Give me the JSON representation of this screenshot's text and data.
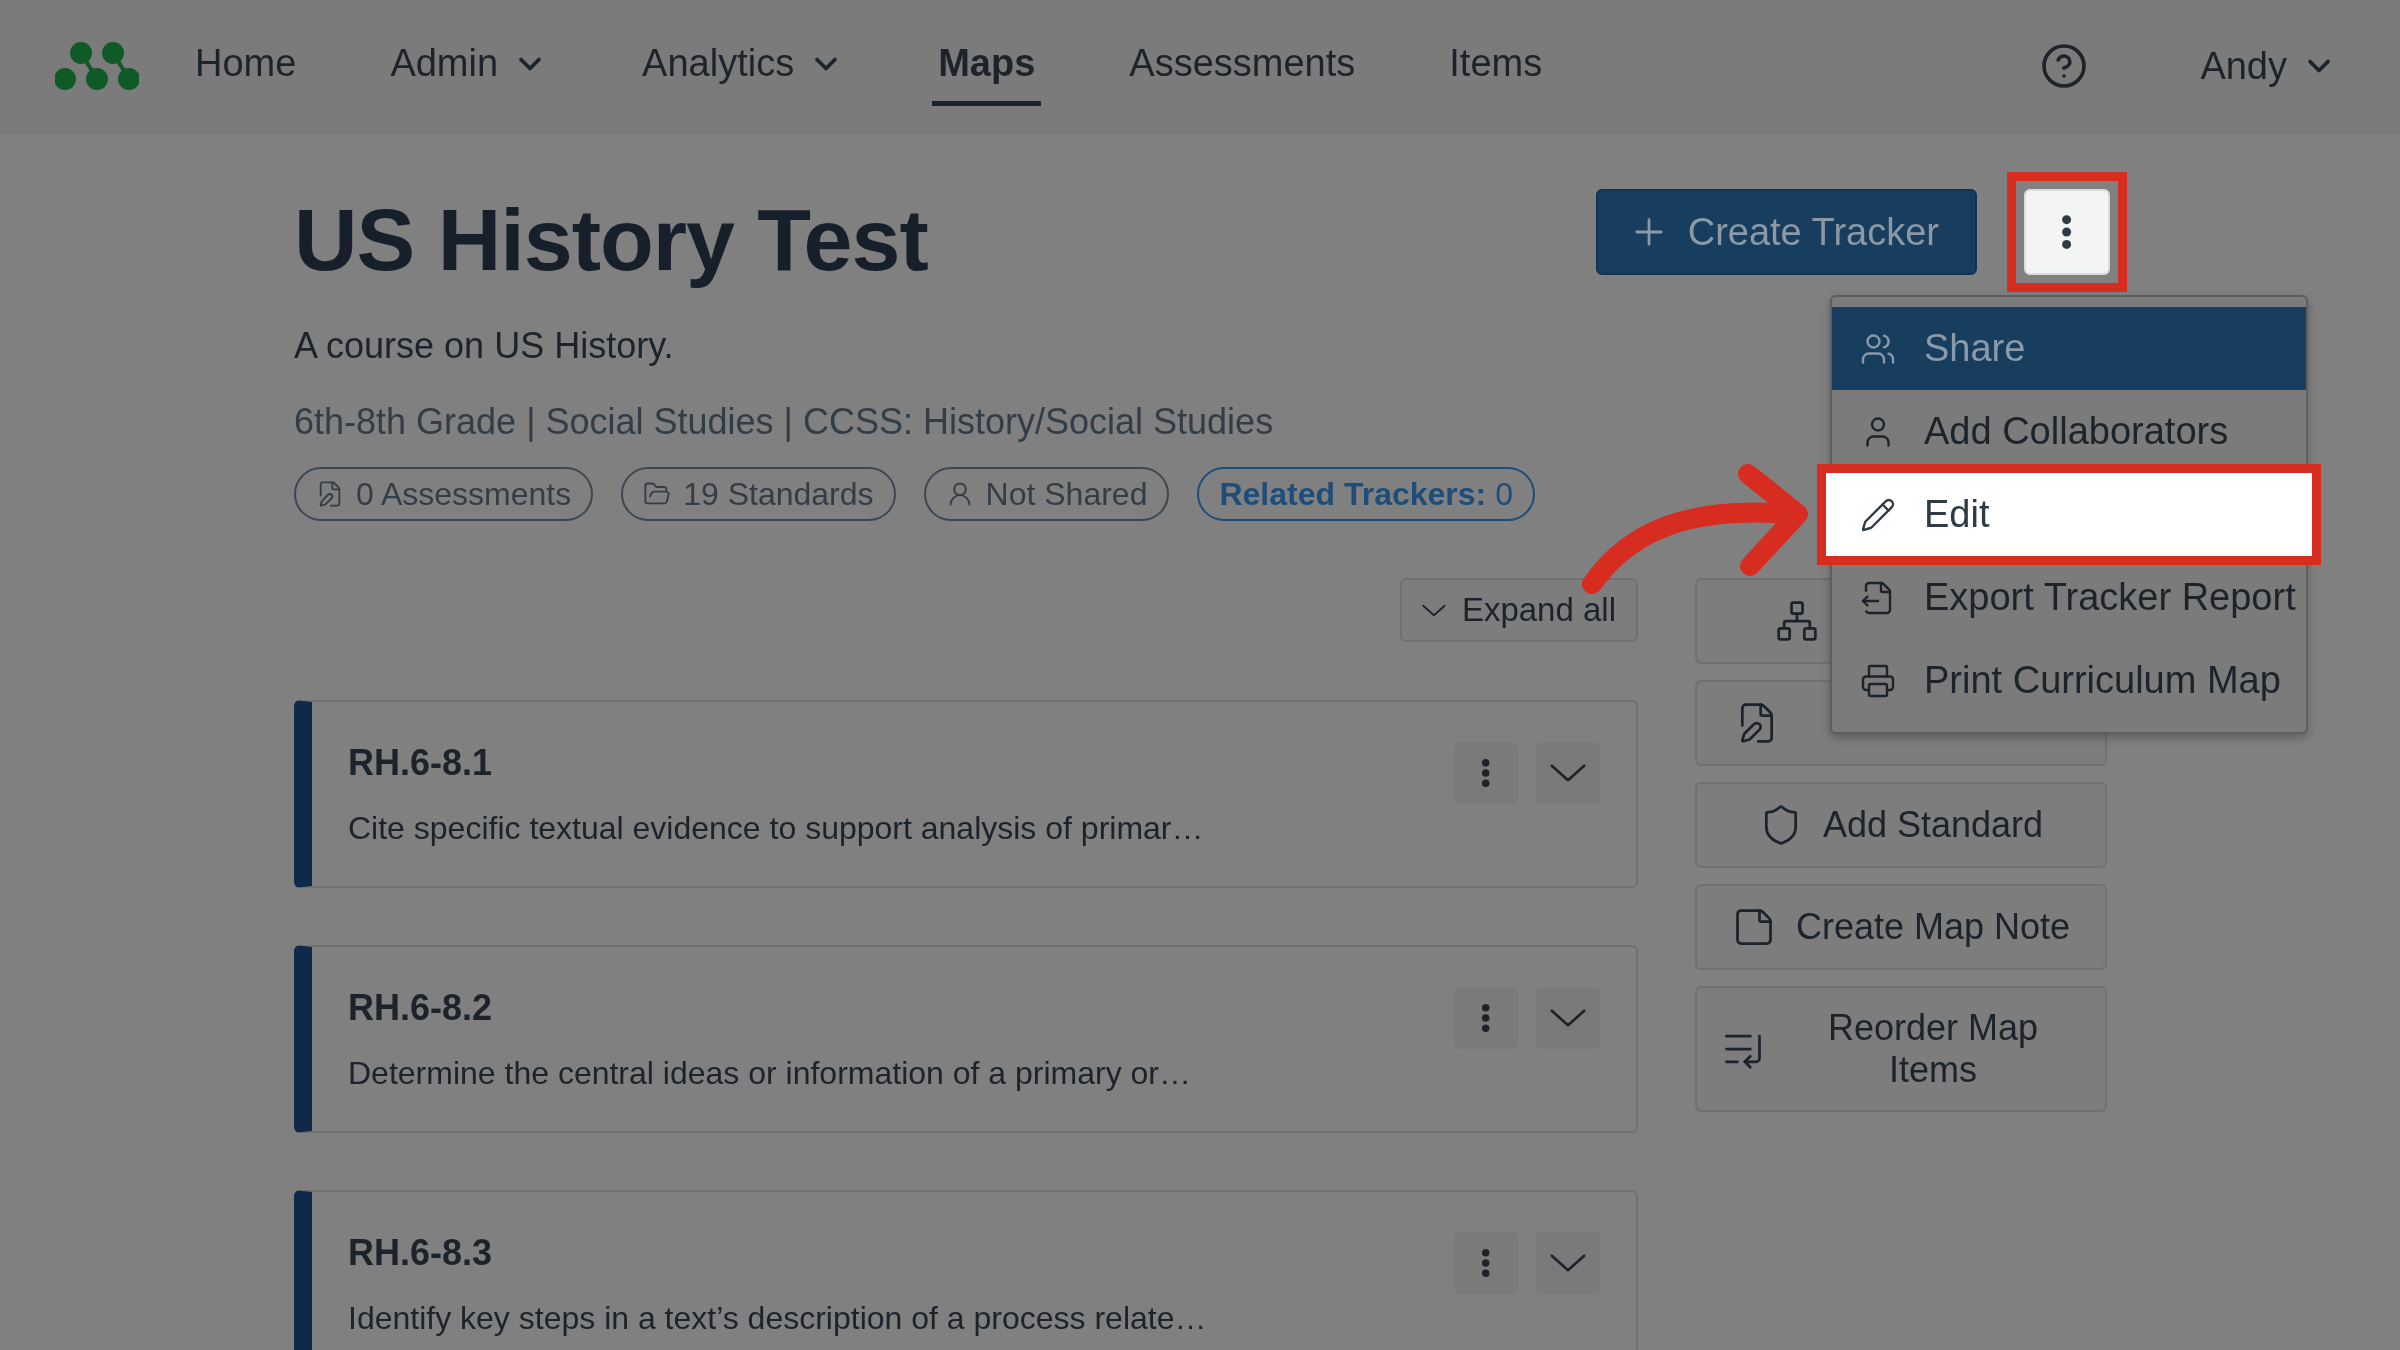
{
  "nav": {
    "items": [
      {
        "label": "Home",
        "selected": false,
        "has_caret": false
      },
      {
        "label": "Admin",
        "selected": false,
        "has_caret": true
      },
      {
        "label": "Analytics",
        "selected": false,
        "has_caret": true
      },
      {
        "label": "Maps",
        "selected": true,
        "has_caret": false
      },
      {
        "label": "Assessments",
        "selected": false,
        "has_caret": false
      },
      {
        "label": "Items",
        "selected": false,
        "has_caret": false
      }
    ],
    "user": {
      "name": "Andy"
    }
  },
  "page": {
    "title": "US History Test",
    "description": "A course on US History.",
    "meta": "6th-8th Grade | Social Studies | CCSS: History/Social Studies",
    "pills": [
      {
        "kind": "assessments",
        "label": "0 Assessments"
      },
      {
        "kind": "standards",
        "label": "19 Standards"
      },
      {
        "kind": "sharing",
        "label": "Not Shared"
      },
      {
        "kind": "related",
        "label": "**Related Trackers:** 0"
      }
    ]
  },
  "create_button": {
    "label": "Create Tracker"
  },
  "more_button": {
    "callout": true
  },
  "menu": {
    "items": [
      {
        "kind": "share",
        "label": "Share",
        "highlighted": true,
        "callout": false
      },
      {
        "kind": "collaborators",
        "label": "Add Collaborators",
        "highlighted": false,
        "callout": false
      },
      {
        "kind": "edit",
        "label": "Edit",
        "highlighted": false,
        "callout": true
      },
      {
        "kind": "export",
        "label": "Export Tracker Report",
        "highlighted": false,
        "callout": false
      },
      {
        "kind": "print",
        "label": "Print Curriculum Map",
        "highlighted": false,
        "callout": false
      }
    ]
  },
  "expand_button": {
    "label": "Expand all"
  },
  "actions": [
    {
      "kind": "tracker"
    },
    {
      "kind": "assessment"
    },
    {
      "kind": "standard",
      "label": "Add Standard"
    },
    {
      "kind": "note",
      "label": "Create Map Note"
    },
    {
      "kind": "reorder",
      "label": "Reorder Map Items"
    }
  ],
  "cards": [
    {
      "code": "RH.6-8.1",
      "description": "Cite specific textual evidence to support analysis of primar…"
    },
    {
      "code": "RH.6-8.2",
      "description": "Determine the central ideas or information of a primary or…"
    },
    {
      "code": "RH.6-8.3",
      "description": "Identify key steps in a text’s description of a process relate…"
    }
  ],
  "annotation": {
    "kind": "arrow"
  }
}
